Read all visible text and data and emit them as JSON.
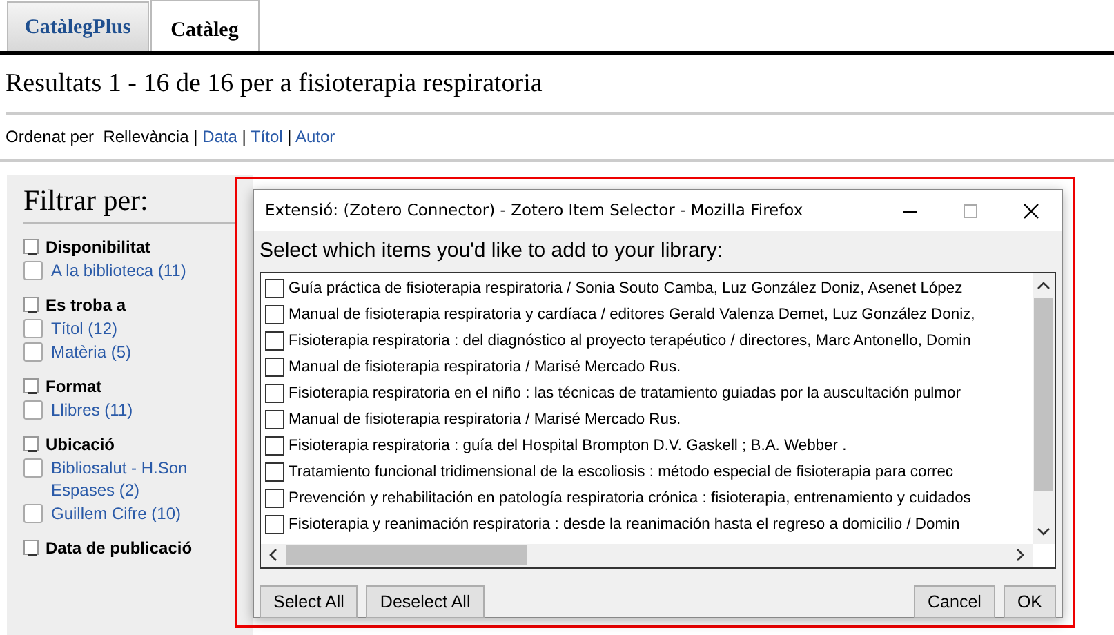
{
  "tabs": [
    {
      "label": "CatàlegPlus",
      "selected": false
    },
    {
      "label": "Catàleg",
      "selected": true
    }
  ],
  "heading": "Resultats 1 - 16 de 16 per a fisioterapia respiratoria",
  "sort": {
    "label": "Ordenat per",
    "separator": "|",
    "options": [
      {
        "label": "Rellevància",
        "selected": true
      },
      {
        "label": "Data",
        "selected": false
      },
      {
        "label": "Títol",
        "selected": false
      },
      {
        "label": "Autor",
        "selected": false
      }
    ]
  },
  "sidebar": {
    "title": "Filtrar per:",
    "groups": [
      {
        "title": "Disponibilitat",
        "expanded": true,
        "items": [
          {
            "label": "A la biblioteca (11)",
            "checked": false
          }
        ]
      },
      {
        "title": "Es troba a",
        "expanded": true,
        "items": [
          {
            "label": "Títol (12)",
            "checked": false
          },
          {
            "label": "Matèria (5)",
            "checked": false
          }
        ]
      },
      {
        "title": "Format",
        "expanded": true,
        "items": [
          {
            "label": "Llibres (11)",
            "checked": false
          }
        ]
      },
      {
        "title": "Ubicació",
        "expanded": true,
        "items": [
          {
            "label": "Bibliosalut - H.Son Espases (2)",
            "checked": false
          },
          {
            "label": "Guillem Cifre (10)",
            "checked": false
          }
        ]
      },
      {
        "title": "Data de publicació",
        "expanded": true
      }
    ]
  },
  "dialog": {
    "title": "Extensió: (Zotero Connector) - Zotero Item Selector - Mozilla Firefox",
    "prompt": "Select which items you'd like to add to your library:",
    "items": [
      {
        "label": "Guía práctica de fisioterapia respiratoria / Sonia Souto Camba, Luz González Doniz, Asenet López",
        "checked": false
      },
      {
        "label": "Manual de fisioterapia respiratoria y cardíaca / editores Gerald Valenza Demet, Luz González Doniz,",
        "checked": false
      },
      {
        "label": "Fisioterapia respiratoria : del diagnóstico al proyecto terapéutico / directores, Marc Antonello, Domin",
        "checked": false
      },
      {
        "label": "Manual de fisioterapia respiratoria / Marisé Mercado Rus.",
        "checked": false
      },
      {
        "label": "Fisioterapia respiratoria en el niño : las técnicas de tratamiento guiadas por la auscultación pulmor",
        "checked": false
      },
      {
        "label": "Manual de fisioterapia respiratoria / Marisé Mercado Rus.",
        "checked": false
      },
      {
        "label": "Fisioterapia respiratoria : guía del Hospital Brompton D.V. Gaskell ; B.A. Webber .",
        "checked": false
      },
      {
        "label": "Tratamiento funcional tridimensional de la escoliosis : método especial de fisioterapia para correc",
        "checked": false
      },
      {
        "label": "Prevención y rehabilitación en patología respiratoria crónica : fisioterapia, entrenamiento y cuidados",
        "checked": false
      },
      {
        "label": "Fisioterapia y reanimación respiratoria : desde la reanimación hasta el regreso a domicilio / Domin",
        "checked": false
      }
    ],
    "buttons_left": [
      "Select All",
      "Deselect All"
    ],
    "buttons_right": [
      "Cancel",
      "OK"
    ]
  }
}
